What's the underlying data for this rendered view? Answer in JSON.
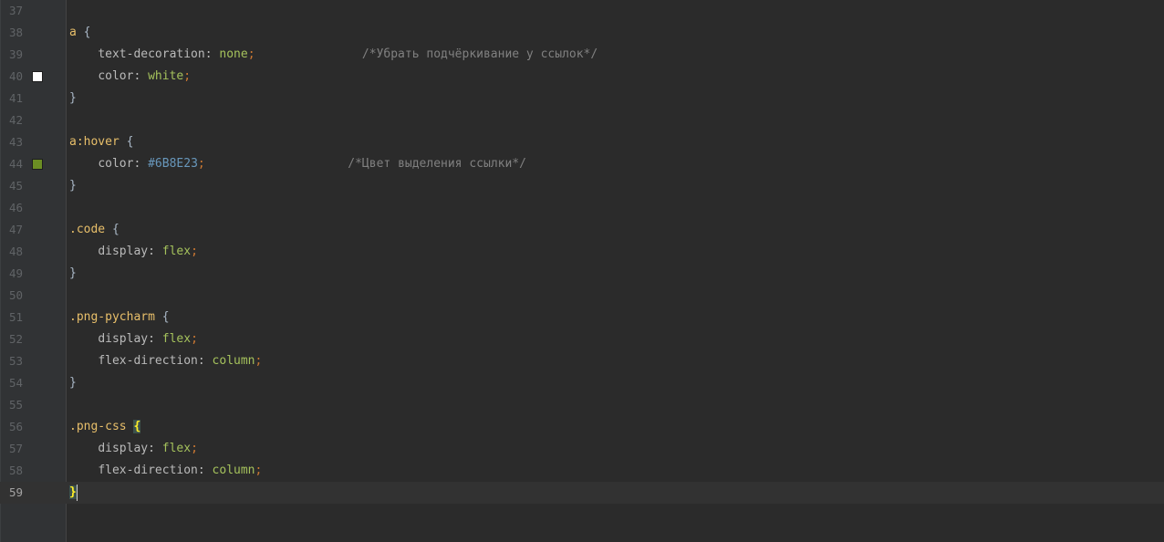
{
  "editor": {
    "current_line": 59,
    "color_swatches": {
      "white": "#ffffff",
      "olive": "#6B8E23"
    },
    "lines": [
      {
        "num": "37",
        "tokens": []
      },
      {
        "num": "38",
        "tokens": [
          {
            "t": "a",
            "c": "sel"
          },
          {
            "t": " "
          },
          {
            "t": "{",
            "c": "brace"
          }
        ]
      },
      {
        "num": "39",
        "tokens": [
          {
            "t": "    "
          },
          {
            "t": "text-decoration",
            "c": "prop"
          },
          {
            "t": ": ",
            "c": "prop"
          },
          {
            "t": "none",
            "c": "val"
          },
          {
            "t": ";",
            "c": "punc"
          },
          {
            "t": "               "
          },
          {
            "t": "/*Убрать подчёркивание у ссылок*/",
            "c": "comment"
          }
        ]
      },
      {
        "num": "40",
        "swatch": "white",
        "tokens": [
          {
            "t": "    "
          },
          {
            "t": "color",
            "c": "prop"
          },
          {
            "t": ": ",
            "c": "prop"
          },
          {
            "t": "white",
            "c": "val"
          },
          {
            "t": ";",
            "c": "punc"
          }
        ]
      },
      {
        "num": "41",
        "tokens": [
          {
            "t": "}",
            "c": "brace"
          }
        ]
      },
      {
        "num": "42",
        "tokens": []
      },
      {
        "num": "43",
        "tokens": [
          {
            "t": "a:hover",
            "c": "sel"
          },
          {
            "t": " "
          },
          {
            "t": "{",
            "c": "brace"
          }
        ]
      },
      {
        "num": "44",
        "swatch": "olive",
        "tokens": [
          {
            "t": "    "
          },
          {
            "t": "color",
            "c": "prop"
          },
          {
            "t": ": ",
            "c": "prop"
          },
          {
            "t": "#6B8E23",
            "c": "hex"
          },
          {
            "t": ";",
            "c": "punc"
          },
          {
            "t": "                    "
          },
          {
            "t": "/*Цвет выделения ссылки*/",
            "c": "comment"
          }
        ]
      },
      {
        "num": "45",
        "tokens": [
          {
            "t": "}",
            "c": "brace"
          }
        ]
      },
      {
        "num": "46",
        "tokens": []
      },
      {
        "num": "47",
        "tokens": [
          {
            "t": ".code",
            "c": "sel"
          },
          {
            "t": " "
          },
          {
            "t": "{",
            "c": "brace"
          }
        ]
      },
      {
        "num": "48",
        "tokens": [
          {
            "t": "    "
          },
          {
            "t": "display",
            "c": "prop"
          },
          {
            "t": ": ",
            "c": "prop"
          },
          {
            "t": "flex",
            "c": "val"
          },
          {
            "t": ";",
            "c": "punc"
          }
        ]
      },
      {
        "num": "49",
        "tokens": [
          {
            "t": "}",
            "c": "brace"
          }
        ]
      },
      {
        "num": "50",
        "tokens": []
      },
      {
        "num": "51",
        "tokens": [
          {
            "t": ".png-pycharm",
            "c": "sel"
          },
          {
            "t": " "
          },
          {
            "t": "{",
            "c": "brace"
          }
        ]
      },
      {
        "num": "52",
        "tokens": [
          {
            "t": "    "
          },
          {
            "t": "display",
            "c": "prop"
          },
          {
            "t": ": ",
            "c": "prop"
          },
          {
            "t": "flex",
            "c": "val"
          },
          {
            "t": ";",
            "c": "punc"
          }
        ]
      },
      {
        "num": "53",
        "tokens": [
          {
            "t": "    "
          },
          {
            "t": "flex-direction",
            "c": "prop"
          },
          {
            "t": ": ",
            "c": "prop"
          },
          {
            "t": "column",
            "c": "val"
          },
          {
            "t": ";",
            "c": "punc"
          }
        ]
      },
      {
        "num": "54",
        "tokens": [
          {
            "t": "}",
            "c": "brace"
          }
        ]
      },
      {
        "num": "55",
        "tokens": []
      },
      {
        "num": "56",
        "tokens": [
          {
            "t": ".png-css",
            "c": "sel"
          },
          {
            "t": " "
          },
          {
            "t": "{",
            "c": "brace matched"
          }
        ]
      },
      {
        "num": "57",
        "tokens": [
          {
            "t": "    "
          },
          {
            "t": "display",
            "c": "prop"
          },
          {
            "t": ": ",
            "c": "prop"
          },
          {
            "t": "flex",
            "c": "val"
          },
          {
            "t": ";",
            "c": "punc"
          }
        ]
      },
      {
        "num": "58",
        "tokens": [
          {
            "t": "    "
          },
          {
            "t": "flex-direction",
            "c": "prop"
          },
          {
            "t": ": ",
            "c": "prop"
          },
          {
            "t": "column",
            "c": "val"
          },
          {
            "t": ";",
            "c": "punc"
          }
        ]
      },
      {
        "num": "59",
        "caret": true,
        "tokens": [
          {
            "t": "}",
            "c": "brace matched"
          }
        ]
      }
    ]
  }
}
